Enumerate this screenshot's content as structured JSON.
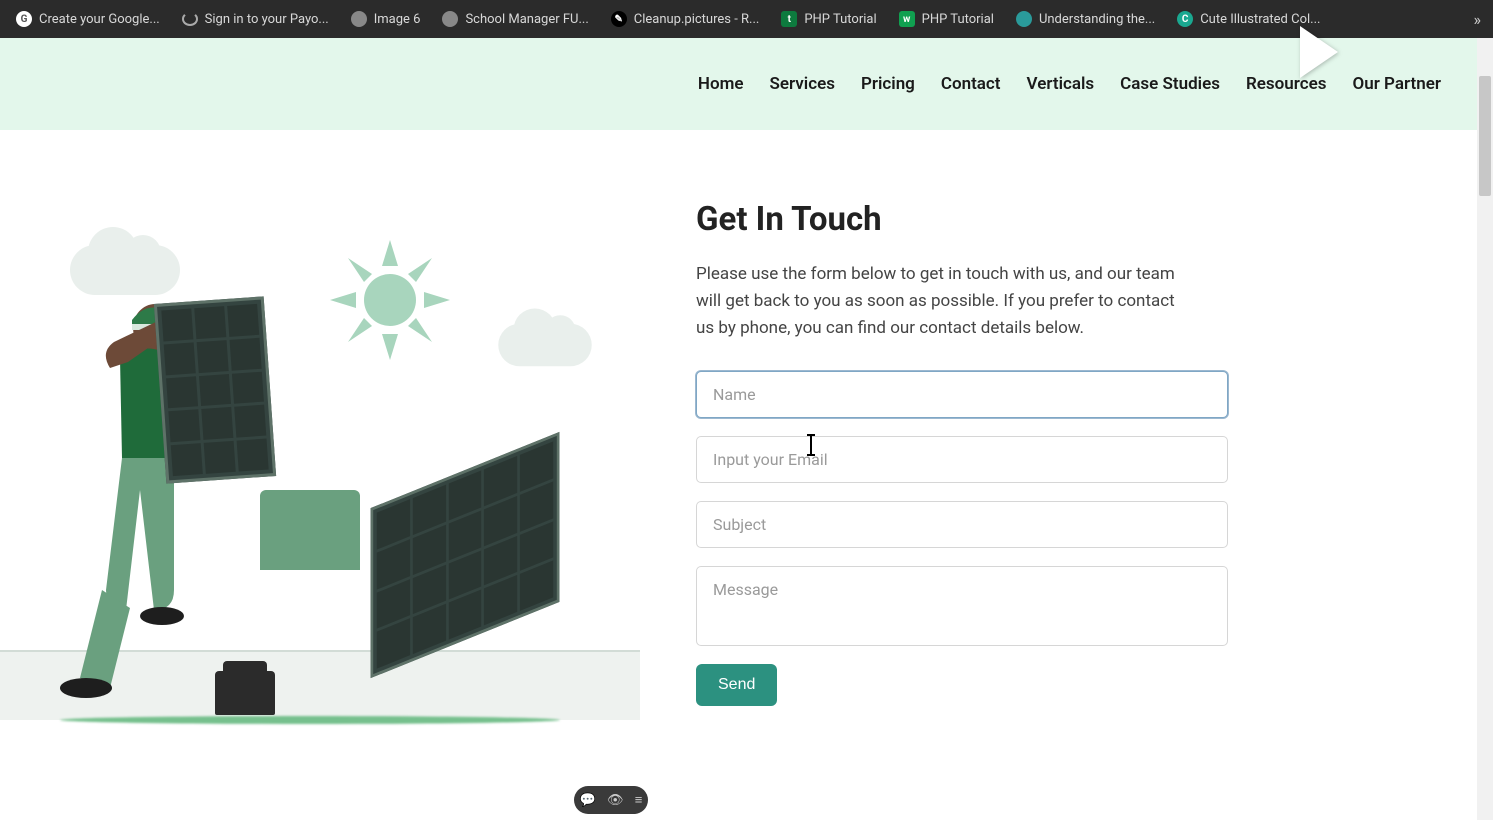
{
  "browser_tabs": [
    {
      "label": "Create your Google...",
      "favclass": "fi-g",
      "favglyph": "G",
      "name": "tab-google"
    },
    {
      "label": "Sign in to your Payo...",
      "favclass": "fi-s",
      "favglyph": "",
      "name": "tab-payo"
    },
    {
      "label": "Image 6",
      "favclass": "fi-globe",
      "favglyph": "",
      "name": "tab-image6"
    },
    {
      "label": "School Manager FU...",
      "favclass": "fi-globe",
      "favglyph": "",
      "name": "tab-school"
    },
    {
      "label": "Cleanup.pictures - R...",
      "favclass": "fi-brush",
      "favglyph": "✎",
      "name": "tab-cleanup"
    },
    {
      "label": "PHP Tutorial",
      "favclass": "fi-php",
      "favglyph": "t",
      "name": "tab-php1"
    },
    {
      "label": "PHP Tutorial",
      "favclass": "fi-w",
      "favglyph": "w",
      "name": "tab-php2"
    },
    {
      "label": "Understanding the...",
      "favclass": "fi-teal",
      "favglyph": "",
      "name": "tab-understanding"
    },
    {
      "label": "Cute Illustrated Col...",
      "favclass": "fi-c",
      "favglyph": "C",
      "name": "tab-cute"
    }
  ],
  "nav": [
    "Home",
    "Services",
    "Pricing",
    "Contact",
    "Verticals",
    "Case Studies",
    "Resources",
    "Our Partner"
  ],
  "contact": {
    "title": "Get In Touch",
    "desc": "Please use the form below to get in touch with us, and our team will get back to you as soon as possible. If you prefer to contact us by phone, you can find our contact details below.",
    "name_placeholder": "Name",
    "email_placeholder": "Input your Email",
    "subject_placeholder": "Subject",
    "message_placeholder": "Message",
    "send_label": "Send"
  },
  "pill_icons": {
    "a": "💬",
    "b": "👁",
    "c": "≡"
  },
  "overflow_glyph": "»"
}
